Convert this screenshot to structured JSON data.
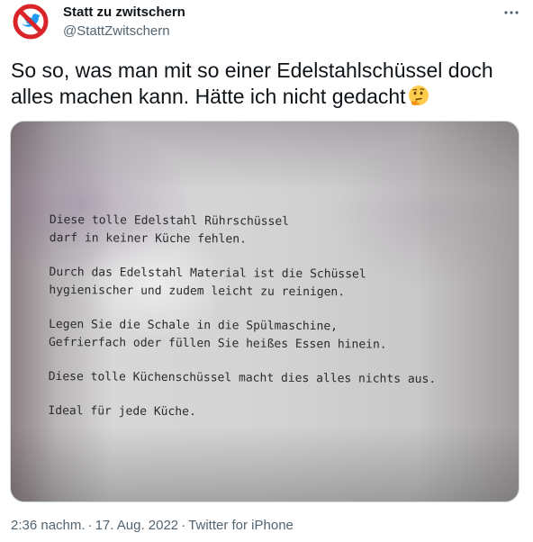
{
  "author": {
    "display_name": "Statt zu zwitschern",
    "handle": "@StattZwitschern"
  },
  "tweet": {
    "text": "So so, was man mit so einer Edelstahlschüssel doch alles machen kann. Hätte ich nicht gedacht",
    "emoji_icon": "thinking-face-icon"
  },
  "media": {
    "lines": [
      "Diese tolle Edelstahl Rührschüssel\ndarf in keiner Küche fehlen.",
      "Durch das Edelstahl Material ist die Schüssel\nhygienischer und zudem leicht zu reinigen.",
      "Legen Sie die Schale in die Spülmaschine,\nGefrierfach oder füllen Sie heißes Essen hinein.",
      "Diese tolle Küchenschüssel macht dies alles nichts aus.",
      "Ideal für jede Küche."
    ]
  },
  "meta": {
    "time": "2:36 nachm.",
    "separator": "·",
    "date": "17. Aug. 2022",
    "source": "Twitter for iPhone"
  },
  "colors": {
    "avatar_ring": "#d9242a",
    "twitter_blue": "#1d9bf0",
    "secondary_text": "#536471"
  }
}
